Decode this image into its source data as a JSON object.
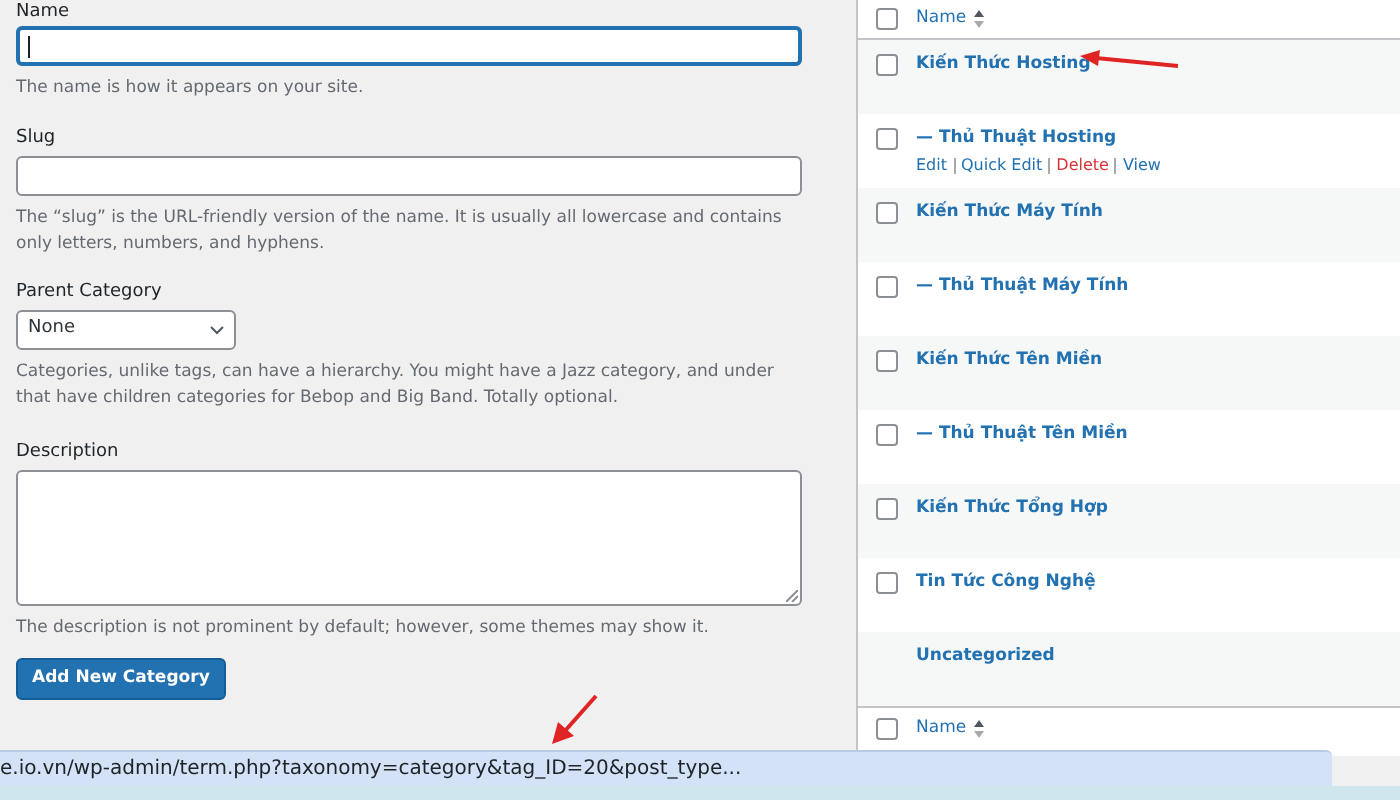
{
  "form": {
    "name": {
      "label": "Name",
      "hint": "The name is how it appears on your site."
    },
    "slug": {
      "label": "Slug",
      "hint": "The “slug” is the URL-friendly version of the name. It is usually all lowercase and contains only letters, numbers, and hyphens."
    },
    "parent": {
      "label": "Parent Category",
      "value": "None",
      "hint": "Categories, unlike tags, can have a hierarchy. You might have a Jazz category, and under that have children categories for Bebop and Big Band. Totally optional."
    },
    "description": {
      "label": "Description",
      "hint": "The description is not prominent by default; however, some themes may show it."
    },
    "submit": "Add New Category"
  },
  "table": {
    "header": "Name",
    "header_checked": false,
    "footer": "Name",
    "footer_checked": false,
    "rows": [
      {
        "name": "Kiến Thức Hosting",
        "checked": false
      },
      {
        "name": "— Thủ Thuật Hosting",
        "checked": false,
        "actions": [
          {
            "label": "Edit",
            "kind": "normal"
          },
          {
            "label": "Quick Edit",
            "kind": "normal"
          },
          {
            "label": "Delete",
            "kind": "delete"
          },
          {
            "label": "View",
            "kind": "normal"
          }
        ]
      },
      {
        "name": "Kiến Thức Máy Tính",
        "checked": false
      },
      {
        "name": "— Thủ Thuật Máy Tính",
        "checked": false
      },
      {
        "name": "Kiến Thức Tên Miền",
        "checked": false
      },
      {
        "name": "— Thủ Thuật Tên Miền",
        "checked": false
      },
      {
        "name": "Kiến Thức Tổng Hợp",
        "checked": false
      },
      {
        "name": "Tin Tức Công Nghệ",
        "checked": false
      },
      {
        "name": "Uncategorized"
      }
    ]
  },
  "status_bar": {
    "url": "e.io.vn/wp-admin/term.php?taxonomy=category&tag_ID=20&post_type..."
  }
}
